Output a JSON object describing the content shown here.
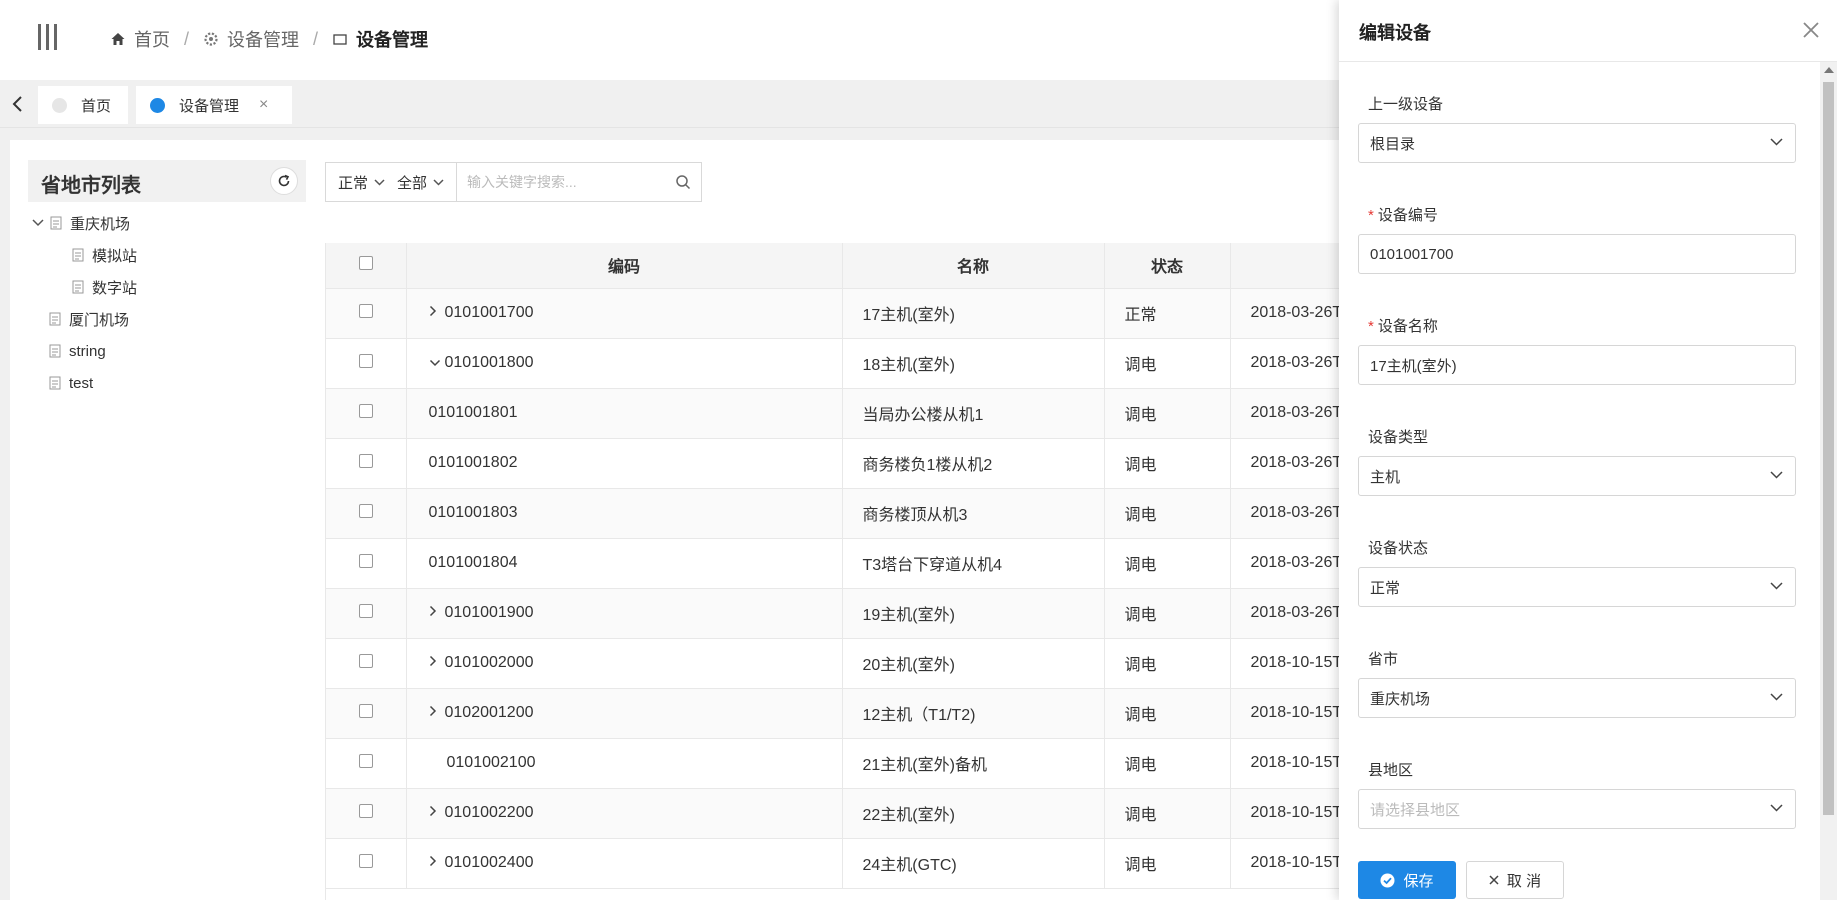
{
  "breadcrumb": {
    "home": "首页",
    "section": "设备管理",
    "current": "设备管理"
  },
  "tabs": [
    {
      "label": "首页",
      "active": false
    },
    {
      "label": "设备管理",
      "active": true,
      "close": "×"
    }
  ],
  "tree": {
    "title": "省地市列表",
    "nodes": {
      "chongqing": "重庆机场",
      "moni": "模拟站",
      "shuzi": "数字站",
      "xiamen": "厦门机场",
      "string": "string",
      "test": "test"
    }
  },
  "toolbar": {
    "status_filter": "正常",
    "scope_filter": "全部",
    "search_placeholder": "输入关键字搜索..."
  },
  "table": {
    "headers": {
      "code": "编码",
      "name": "名称",
      "status": "状态"
    },
    "rows": [
      {
        "code": "0101001700",
        "name": "17主机(室外)",
        "status": "正常",
        "time": "2018-03-26T"
      },
      {
        "code": "0101001800",
        "name": "18主机(室外)",
        "status": "调电",
        "time": "2018-03-26T"
      },
      {
        "code": "0101001801",
        "name": "当局办公楼从机1",
        "status": "调电",
        "time": "2018-03-26T"
      },
      {
        "code": "0101001802",
        "name": "商务楼负1楼从机2",
        "status": "调电",
        "time": "2018-03-26T"
      },
      {
        "code": "0101001803",
        "name": "商务楼顶从机3",
        "status": "调电",
        "time": "2018-03-26T"
      },
      {
        "code": "0101001804",
        "name": "T3塔台下穿道从机4",
        "status": "调电",
        "time": "2018-03-26T"
      },
      {
        "code": "0101001900",
        "name": "19主机(室外)",
        "status": "调电",
        "time": "2018-03-26T"
      },
      {
        "code": "0101002000",
        "name": "20主机(室外)",
        "status": "调电",
        "time": "2018-10-15T"
      },
      {
        "code": "0102001200",
        "name": "12主机（T1/T2)",
        "status": "调电",
        "time": "2018-10-15T"
      },
      {
        "code": "0101002100",
        "name": "21主机(室外)备机",
        "status": "调电",
        "time": "2018-10-15T"
      },
      {
        "code": "0101002200",
        "name": "22主机(室外)",
        "status": "调电",
        "time": "2018-10-15T"
      },
      {
        "code": "0101002400",
        "name": "24主机(GTC)",
        "status": "调电",
        "time": "2018-10-15T"
      }
    ]
  },
  "drawer": {
    "title": "编辑设备",
    "fields": {
      "parent": {
        "label": "上一级设备",
        "value": "根目录"
      },
      "code": {
        "label": "设备编号",
        "required_mark": "*",
        "value": "0101001700"
      },
      "name": {
        "label": "设备名称",
        "required_mark": "*",
        "value": "17主机(室外)"
      },
      "type": {
        "label": "设备类型",
        "value": "主机"
      },
      "status": {
        "label": "设备状态",
        "value": "正常"
      },
      "province": {
        "label": "省市",
        "value": "重庆机场"
      },
      "county": {
        "label": "县地区",
        "placeholder": "请选择县地区"
      }
    },
    "buttons": {
      "save": "保存",
      "cancel": "取 消"
    }
  },
  "colors": {
    "accent": "#1e88e5",
    "required": "#e53935"
  }
}
